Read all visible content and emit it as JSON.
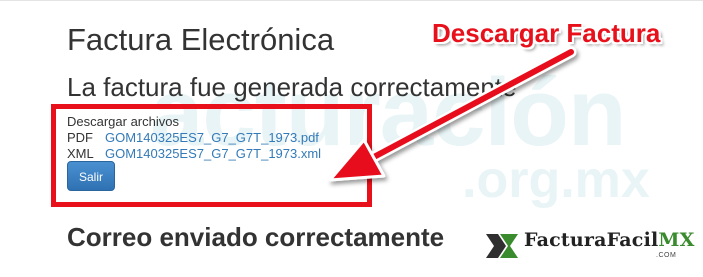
{
  "watermark": {
    "main": "acturación",
    "sub": ".org.mx"
  },
  "page": {
    "title": "Factura Electrónica",
    "status_message": "La factura fue generada correctamente",
    "email_message": "Correo enviado correctamente"
  },
  "downloads": {
    "heading": "Descargar archivos",
    "files": [
      {
        "type": "PDF",
        "name": "GOM140325ES7_G7_G7T_1973.pdf"
      },
      {
        "type": "XML",
        "name": "GOM140325ES7_G7_G7T_1973.xml"
      }
    ],
    "exit_button": "Salir"
  },
  "annotation": {
    "label": "Descargar Factura",
    "color": "#e8101a"
  },
  "logo": {
    "name_main": "FacturaFacil",
    "name_accent": "MX",
    "sub": ".COM"
  },
  "colors": {
    "link": "#337ab7",
    "button": "#3a81c2",
    "highlight": "#e8101a",
    "watermark": "#e8f4f6"
  },
  "icons": [
    "factura-facil-logo-icon",
    "arrow-annotation-icon"
  ]
}
